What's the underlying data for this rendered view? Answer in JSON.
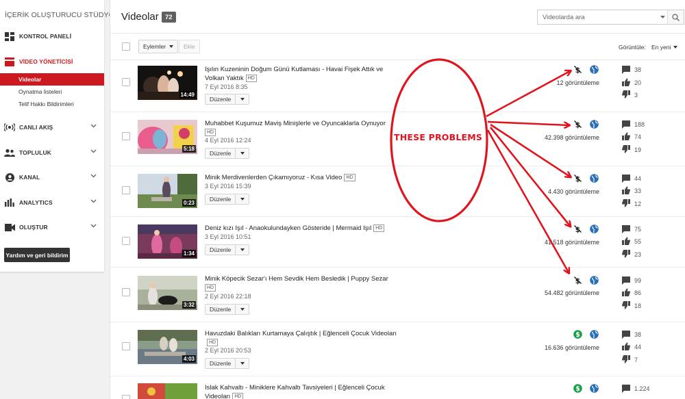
{
  "sidebar": {
    "studio_title": "İÇERİK OLUŞTURUCU STÜDYOSU",
    "nav": {
      "dashboard": "KONTROL PANELİ",
      "video_manager": "VİDEO YÖNETİCİSİ",
      "live": "CANLI AKIŞ",
      "community": "TOPLULUK",
      "channel": "KANAL",
      "analytics": "ANALYTICS",
      "create": "OLUŞTUR"
    },
    "sub": {
      "videos": "Videolar",
      "playlists": "Oynatma listeleri",
      "copyright": "Telif Hakkı Bildirimleri"
    },
    "help_button": "Yardım ve geri bildirim"
  },
  "header": {
    "title": "Videolar",
    "count": "72",
    "search_placeholder": "Videolarda ara"
  },
  "toolbar": {
    "actions": "Eylemler",
    "add": "Ekle",
    "view_label": "Görüntüle:",
    "sort": "En yeni"
  },
  "edit_label": "Düzenle",
  "colors": {
    "accent": "#cc181e",
    "monetized": "#1aa04a",
    "globe": "#2a6fb8",
    "annotation": "#e0141e"
  },
  "videos": [
    {
      "title": "Işılın Kuzeninin Doğum Günü Kutlaması - Havai Fişek Attık ve Volkan Yaktık",
      "hd": "HD",
      "date": "7 Eyl 2016 8:35",
      "duration": "14:49",
      "views": "12 görüntüleme",
      "monetization": "disabled",
      "comments": "38",
      "likes": "20",
      "dislikes": "3"
    },
    {
      "title": "Muhabbet Kuşumuz Maviş Minişlerle ve Oyuncaklarla Oynuyor",
      "hd": "HD",
      "date": "4 Eyl 2016 12:24",
      "duration": "5:18",
      "views": "42.398 görüntüleme",
      "monetization": "disabled",
      "comments": "188",
      "likes": "74",
      "dislikes": "19"
    },
    {
      "title": "Minik Merdivenlerden Çıkamıyoruz - Kısa Video",
      "hd": "HD",
      "date": "3 Eyl 2016 15:39",
      "duration": "0:23",
      "views": "4.430 görüntüleme",
      "monetization": "disabled",
      "comments": "44",
      "likes": "33",
      "dislikes": "12"
    },
    {
      "title": "Deniz kızı Işıl - Anaokulundayken Gösteride | Mermaid Işıl",
      "hd": "HD",
      "date": "3 Eyl 2016 10:51",
      "duration": "1:34",
      "views": "41.518 görüntüleme",
      "monetization": "disabled",
      "comments": "75",
      "likes": "55",
      "dislikes": "23"
    },
    {
      "title": "Minik Köpecik Sezar'ı Hem Sevdik Hem Besledik | Puppy Sezar",
      "hd": "HD",
      "date": "2 Eyl 2016 22:18",
      "duration": "3:32",
      "views": "54.482 görüntüleme",
      "monetization": "disabled",
      "comments": "99",
      "likes": "86",
      "dislikes": "18"
    },
    {
      "title": "Havuzdaki Balıkları Kurtamaya Çalıştık | Eğlenceli Çocuk Videoları",
      "hd": "HD",
      "date": "2 Eyl 2016 20:53",
      "duration": "4:03",
      "views": "16.636 görüntüleme",
      "monetization": "enabled",
      "comments": "38",
      "likes": "44",
      "dislikes": "7"
    },
    {
      "title": "Islak Kahvaltı - Miniklere Kahvaltı Tavsiyeleri | Eğlenceli Çocuk Videoları",
      "hd": "HD",
      "date": "",
      "duration": "",
      "views": "",
      "monetization": "enabled",
      "comments": "1.224",
      "likes": "",
      "dislikes": ""
    }
  ],
  "annotation": {
    "label": "THESE PROBLEMS"
  }
}
